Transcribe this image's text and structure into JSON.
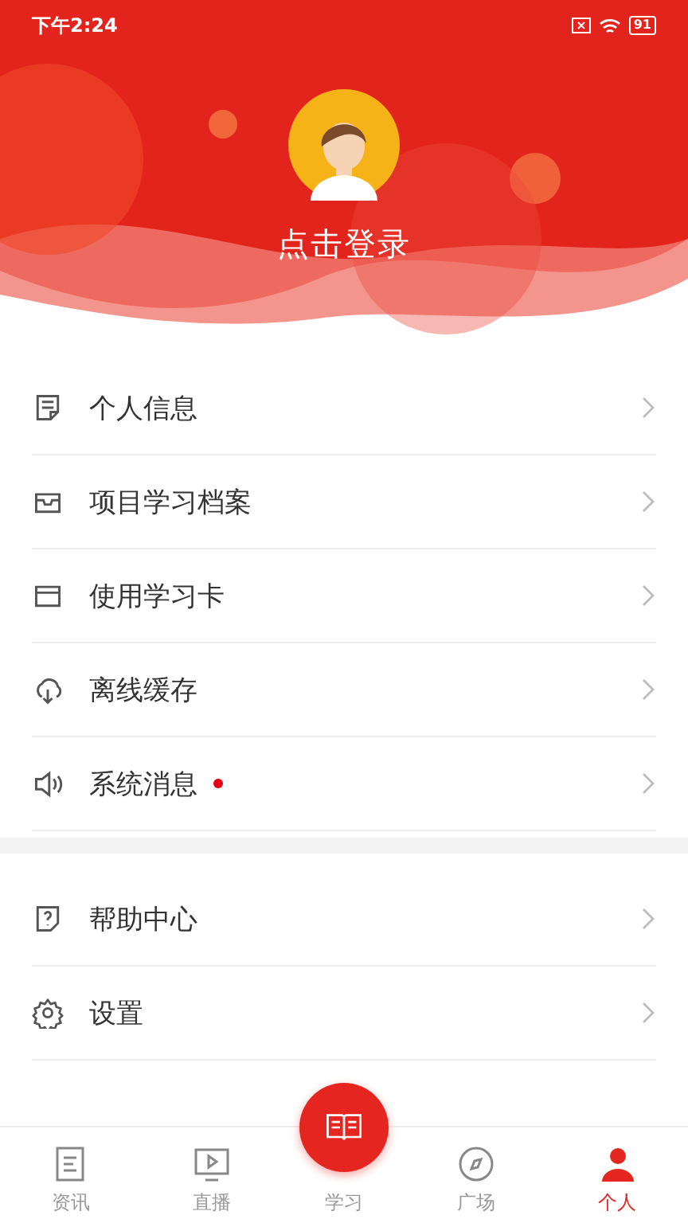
{
  "status_bar": {
    "time": "下午2:24",
    "battery": "91"
  },
  "profile": {
    "login_label": "点击登录"
  },
  "menu_sections": [
    {
      "items": [
        {
          "label": "个人信息",
          "unread": false
        },
        {
          "label": "项目学习档案",
          "unread": false
        },
        {
          "label": "使用学习卡",
          "unread": false
        },
        {
          "label": "离线缓存",
          "unread": false
        },
        {
          "label": "系统消息",
          "unread": true
        }
      ]
    },
    {
      "items": [
        {
          "label": "帮助中心",
          "unread": false
        },
        {
          "label": "设置",
          "unread": false
        }
      ]
    }
  ],
  "bottom_nav": [
    {
      "label": "资讯",
      "kind": "tab",
      "selected": false
    },
    {
      "label": "直播",
      "kind": "tab",
      "selected": false
    },
    {
      "label": "学习",
      "kind": "center",
      "selected": false
    },
    {
      "label": "广场",
      "kind": "tab",
      "selected": false
    },
    {
      "label": "个人",
      "kind": "tab",
      "selected": true
    }
  ]
}
